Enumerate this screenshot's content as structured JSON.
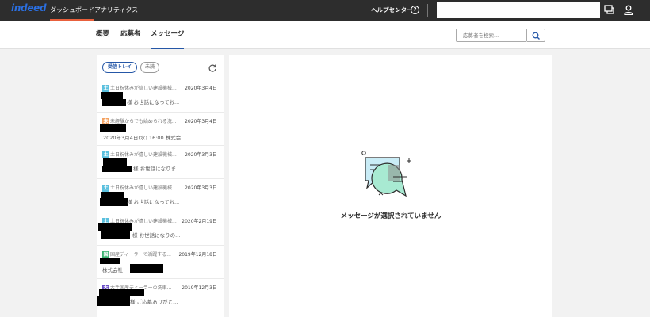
{
  "header": {
    "logo": "indeed",
    "nav": [
      "ダッシュボード",
      "アナリティクス"
    ],
    "help_label": "ヘルプセンター",
    "help_icon_glyph": "?"
  },
  "subnav": {
    "tabs": [
      "概要",
      "応募者",
      "メッセージ"
    ],
    "active_tab": "メッセージ",
    "search_placeholder": "応募者を検索..."
  },
  "message_list": {
    "filters": [
      "受信トレイ",
      "未読"
    ],
    "active_filter": "受信トレイ",
    "items": [
      {
        "badge": "土",
        "badge_color": "#5bc0de",
        "subject": "土日祝休みが嬉しい建設機械...",
        "date": "2020年3月4日",
        "snippet": "様 お世話になってお..."
      },
      {
        "badge": "未",
        "badge_color": "#f4a261",
        "subject": "未経験からでも始められる洗...",
        "date": "2020年3月4日",
        "snippet": "2020年3月4日(水) 16:00 株式会..."
      },
      {
        "badge": "土",
        "badge_color": "#5bc0de",
        "subject": "土日祝休みが嬉しい建設機械...",
        "date": "2020年3月3日",
        "snippet": "様 お世話になりま..."
      },
      {
        "badge": "土",
        "badge_color": "#5bc0de",
        "subject": "土日祝休みが嬉しい建設機械...",
        "date": "2020年3月3日",
        "snippet": "様 お世話になってお..."
      },
      {
        "badge": "土",
        "badge_color": "#5bc0de",
        "subject": "土日祝休みが嬉しい建設機械...",
        "date": "2020年2月19日",
        "snippet": "様 お世話になりの..."
      },
      {
        "badge": "国",
        "badge_color": "#3cb371",
        "subject": "国産ディーラーで活躍する...",
        "date": "2019年12月18日",
        "snippet": "株式会社"
      },
      {
        "badge": "大",
        "badge_color": "#6a4fc7",
        "subject": "大手国産ディーラーの洗車...",
        "date": "2019年12月3日",
        "snippet": "様 ご応募ありがと..."
      }
    ]
  },
  "main": {
    "empty_message": "メッセージが選択されていません"
  }
}
